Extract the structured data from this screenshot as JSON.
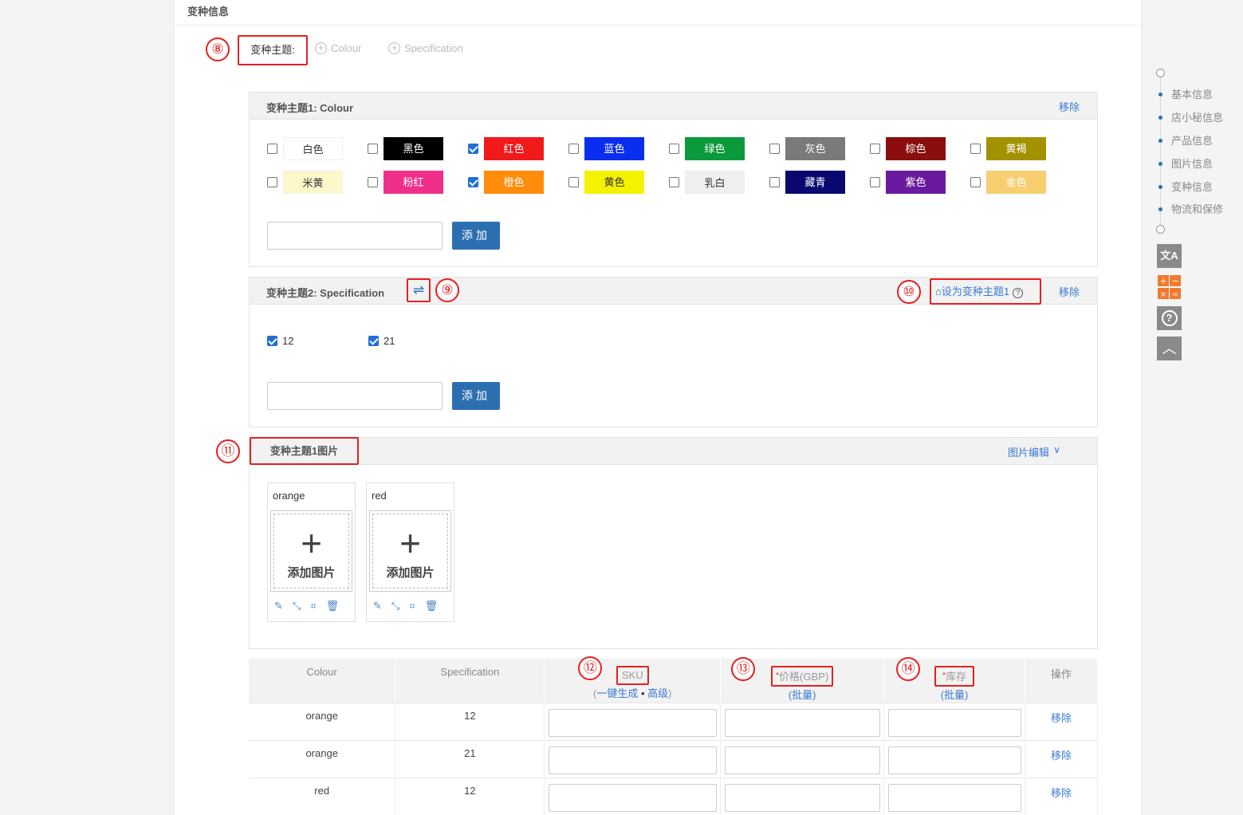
{
  "section": {
    "title": "变种信息"
  },
  "annotations": {
    "n8": "⑧",
    "n9": "⑨",
    "n10": "⑩",
    "n11": "⑪",
    "n12": "⑫",
    "n13": "⑬",
    "n14": "⑭"
  },
  "variant_themes": {
    "label": "变种主题:",
    "options": [
      {
        "label": "Colour"
      },
      {
        "label": "Specification"
      }
    ]
  },
  "theme1": {
    "title": "变种主题1:  Colour",
    "remove": "移除",
    "colors": [
      {
        "label": "白色",
        "bg": "#ffffff",
        "fg": "#333333",
        "checked": false
      },
      {
        "label": "黑色",
        "bg": "#000000",
        "fg": "#ffffff",
        "checked": false
      },
      {
        "label": "红色",
        "bg": "#f01a1a",
        "fg": "#ffffff",
        "checked": true
      },
      {
        "label": "蓝色",
        "bg": "#0a2ef0",
        "fg": "#ffffff",
        "checked": false
      },
      {
        "label": "绿色",
        "bg": "#0a9a3c",
        "fg": "#ffffff",
        "checked": false
      },
      {
        "label": "灰色",
        "bg": "#7a7a7a",
        "fg": "#ffffff",
        "checked": false
      },
      {
        "label": "棕色",
        "bg": "#8a0e0e",
        "fg": "#ffffff",
        "checked": false
      },
      {
        "label": "黄褐",
        "bg": "#a39200",
        "fg": "#ffffff",
        "checked": false
      },
      {
        "label": "米黄",
        "bg": "#fdf7c9",
        "fg": "#333333",
        "checked": false
      },
      {
        "label": "粉红",
        "bg": "#f02f8a",
        "fg": "#ffffff",
        "checked": false
      },
      {
        "label": "橙色",
        "bg": "#ff8c0a",
        "fg": "#ffffff",
        "checked": true
      },
      {
        "label": "黄色",
        "bg": "#f5f200",
        "fg": "#333333",
        "checked": false
      },
      {
        "label": "乳白",
        "bg": "#efefef",
        "fg": "#333333",
        "checked": false
      },
      {
        "label": "藏青",
        "bg": "#08086e",
        "fg": "#ffffff",
        "checked": false
      },
      {
        "label": "紫色",
        "bg": "#6a1a9e",
        "fg": "#ffffff",
        "checked": false
      },
      {
        "label": "金色",
        "bg": "#f7cf70",
        "fg": "#ffffff",
        "checked": false
      }
    ],
    "add_label": "添加"
  },
  "theme2": {
    "title": "变种主题2:  Specification",
    "swap_icon": "⇌",
    "set_theme1": "设为变种主题1",
    "remove": "移除",
    "specs": [
      {
        "label": "12",
        "checked": true
      },
      {
        "label": "21",
        "checked": true
      }
    ],
    "add_label": "添加"
  },
  "images": {
    "title": "变种主题1图片",
    "edit": "图片编辑",
    "cards": [
      {
        "name": "orange",
        "add_label": "添加图片"
      },
      {
        "name": "red",
        "add_label": "添加图片"
      }
    ]
  },
  "table": {
    "headers": {
      "colour": "Colour",
      "spec": "Specification",
      "sku": "SKU",
      "sku_generate": "一键生成",
      "sku_sep": " • ",
      "sku_advanced": "高级",
      "price": "价格(GBP)",
      "price_batch": "(批量)",
      "stock": "库存",
      "stock_batch": "(批量)",
      "action": "操作",
      "required_mark": "*"
    },
    "rows": [
      {
        "colour": "orange",
        "spec": "12",
        "action": "移除"
      },
      {
        "colour": "orange",
        "spec": "21",
        "action": "移除"
      },
      {
        "colour": "red",
        "spec": "12",
        "action": "移除"
      }
    ]
  },
  "right_nav": {
    "items": [
      "基本信息",
      "店小秘信息",
      "产品信息",
      "图片信息",
      "变种信息",
      "物流和保修"
    ]
  },
  "side_buttons": {
    "translate": "文A",
    "help": "?",
    "top": "︿"
  }
}
